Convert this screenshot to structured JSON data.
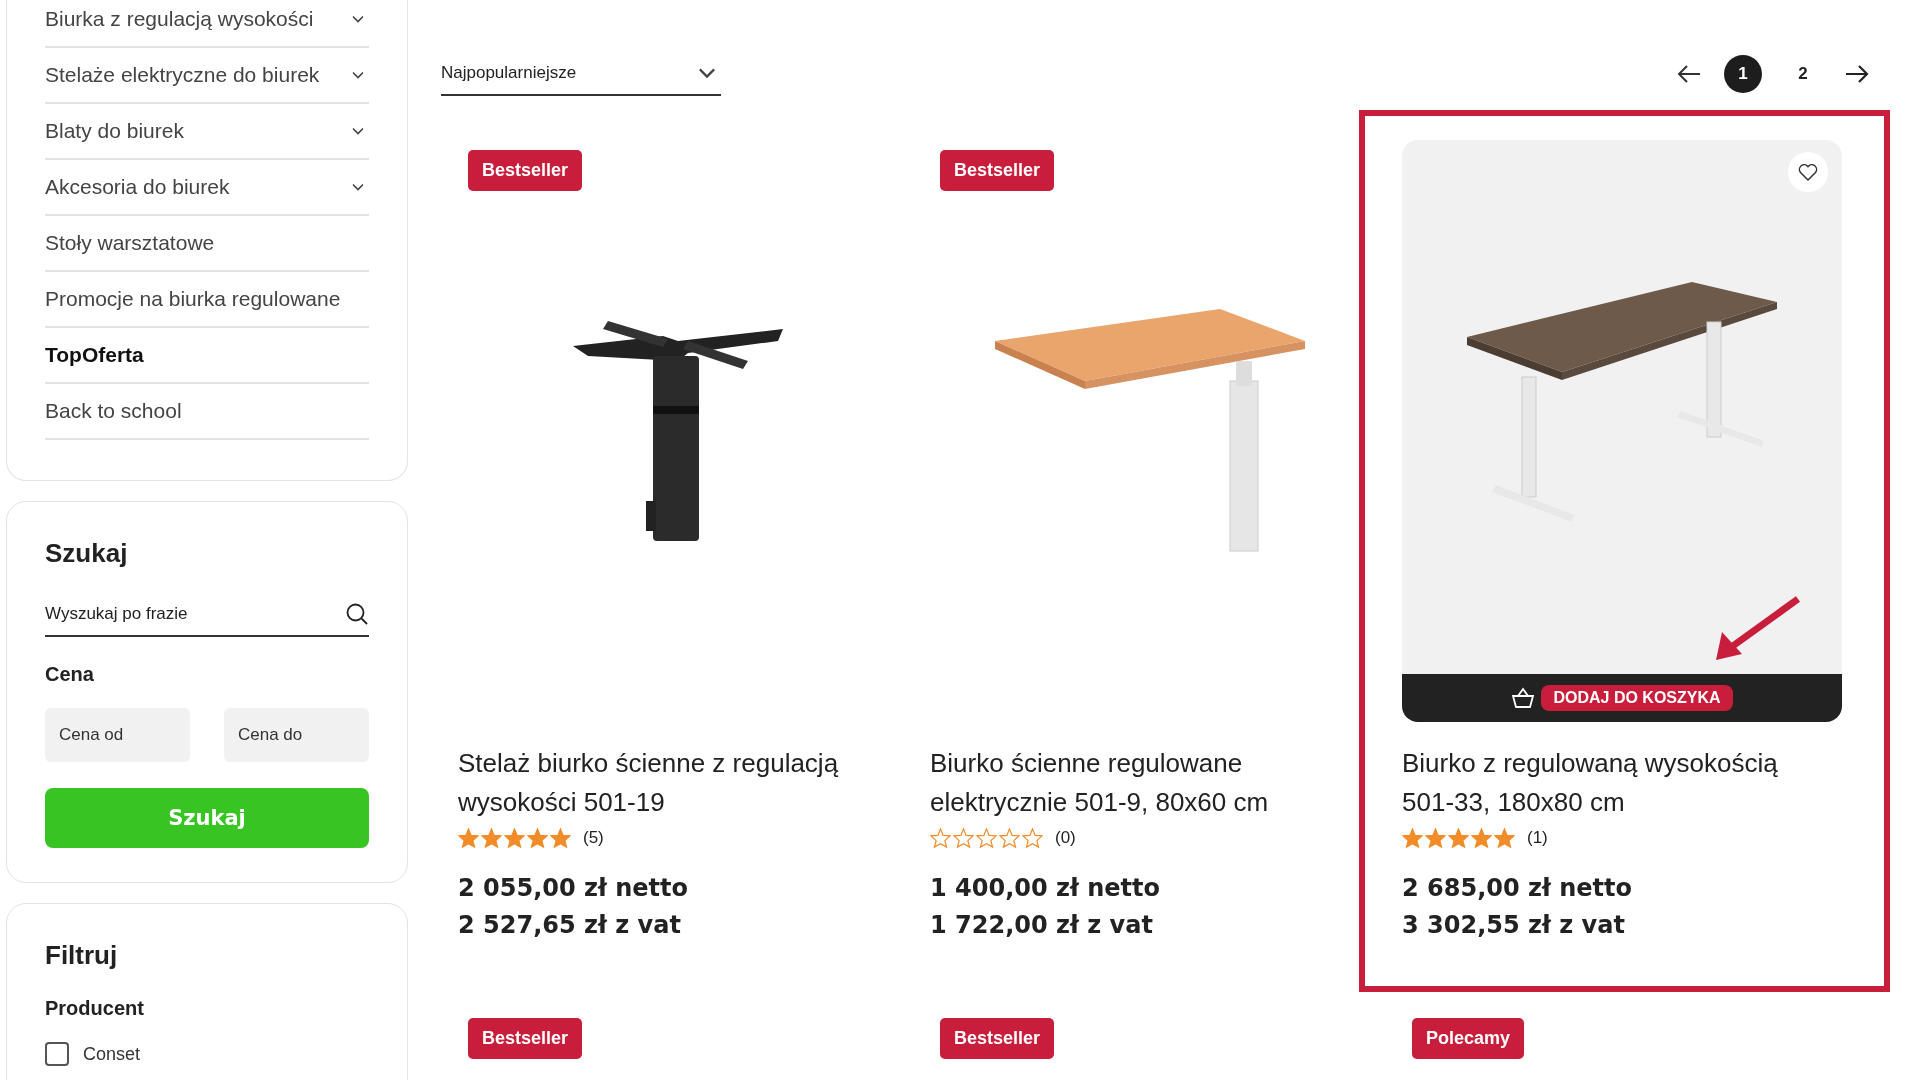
{
  "sidebar": {
    "menu": [
      {
        "label": "Biurka z regulacją wysokości",
        "expandable": true,
        "emphasized": false
      },
      {
        "label": "Stelaże elektryczne do biurek",
        "expandable": true,
        "emphasized": false
      },
      {
        "label": "Blaty do biurek",
        "expandable": true,
        "emphasized": false
      },
      {
        "label": "Akcesoria do biurek",
        "expandable": true,
        "emphasized": false
      },
      {
        "label": "Stoły warsztatowe",
        "expandable": false,
        "emphasized": false
      },
      {
        "label": "Promocje na biurka regulowane",
        "expandable": false,
        "emphasized": false
      },
      {
        "label": "TopOferta",
        "expandable": false,
        "emphasized": true
      },
      {
        "label": "Back to school",
        "expandable": false,
        "emphasized": false
      }
    ],
    "search": {
      "title": "Szukaj",
      "placeholder": "Wyszukaj po frazie",
      "price_label": "Cena",
      "price_from": {
        "placeholder": "Cena od"
      },
      "price_to": {
        "placeholder": "Cena do"
      },
      "button": "Szukaj"
    },
    "filter": {
      "title": "Filtruj",
      "group": "Producent",
      "options": [
        {
          "label": "Conset",
          "checked": false
        }
      ]
    }
  },
  "sort": {
    "value": "Najpopularniejsze"
  },
  "pagination": {
    "pages": [
      {
        "label": "1",
        "selected": true
      },
      {
        "label": "2",
        "selected": false
      }
    ]
  },
  "products": [
    {
      "kind": "frame",
      "badge": "Bestseller",
      "hovered": false,
      "highlighted": false,
      "title": "Stelaż biurko ścienne z regulacją wysokości 501-19",
      "stars": 5,
      "reviews": "(5)",
      "price_net": "2 055,00 zł netto",
      "price_gross": "2 527,65 zł z vat"
    },
    {
      "kind": "wall-desk",
      "badge": "Bestseller",
      "hovered": false,
      "highlighted": false,
      "title": "Biurko ścienne regulowane elektrycznie 501-9, 80x60 cm",
      "stars": 0,
      "reviews": "(0)",
      "price_net": "1 400,00 zł netto",
      "price_gross": "1 722,00 zł z vat"
    },
    {
      "kind": "desk",
      "hovered": true,
      "highlighted": true,
      "add_to_cart": "DODAJ DO KOSZYKA",
      "title": "Biurko z regulowaną wysokością 501-33, 180x80 cm",
      "stars": 5,
      "reviews": "(1)",
      "price_net": "2 685,00 zł netto",
      "price_gross": "3 302,55 zł z vat"
    }
  ],
  "next_products": [
    {
      "badge": "Bestseller"
    },
    {
      "badge": "Bestseller"
    },
    {
      "badge": "Polecamy"
    }
  ]
}
